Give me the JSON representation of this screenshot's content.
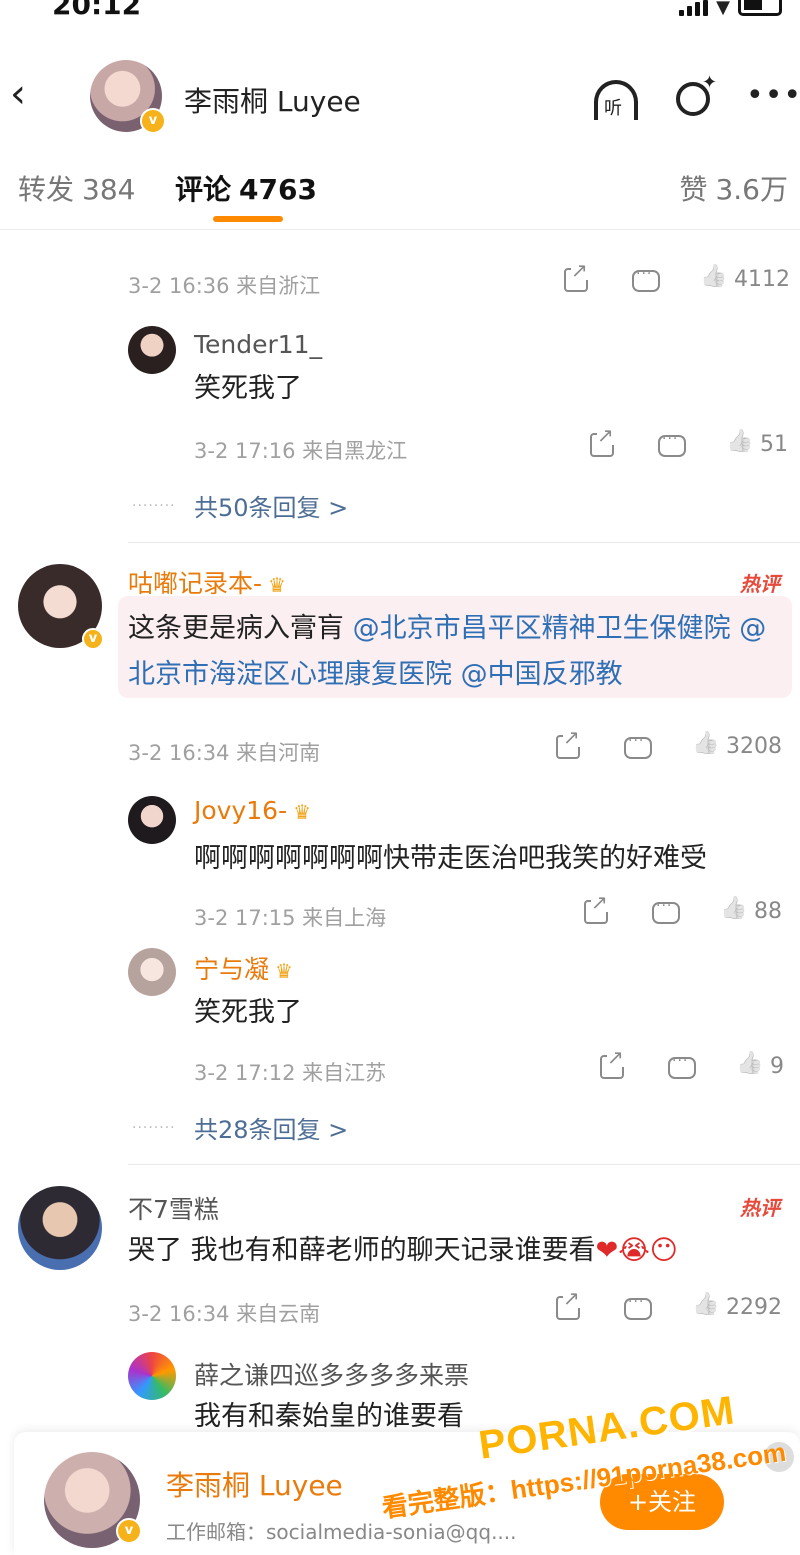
{
  "status_bar": {
    "time": "20:12"
  },
  "header": {
    "title": "李雨桐 Luyee",
    "listen_label": "听"
  },
  "tabs": {
    "forwards_label": "转发",
    "forwards_count": "384",
    "comments_label": "评论",
    "comments_count": "4763",
    "likes_label": "赞",
    "likes_count": "3.6万"
  },
  "comments": [
    {
      "meta": "3-2 16:36 来自浙江",
      "likes": "4112",
      "replies": [
        {
          "user": "Tender11_",
          "text": "笑死我了",
          "meta": "3-2 17:16 来自黑龙江",
          "likes": "51"
        }
      ],
      "more_replies": "共50条回复 >"
    },
    {
      "user": "咕嘟记录本-",
      "hot_badge": "热评",
      "text_parts": [
        "这条更是病入膏肓 ",
        "@北京市昌平区精神卫生保健院",
        " ",
        "@北京市海淀区心理康复医院",
        " ",
        "@中国反邪教"
      ],
      "meta": "3-2 16:34 来自河南",
      "likes": "3208",
      "replies": [
        {
          "user": "Jovy16-",
          "text": "啊啊啊啊啊啊啊快带走医治吧我笑的好难受",
          "meta": "3-2 17:15 来自上海",
          "likes": "88"
        },
        {
          "user": "宁与凝",
          "text": "笑死我了",
          "meta": "3-2 17:12 来自江苏",
          "likes": "9"
        }
      ],
      "more_replies": "共28条回复 >"
    },
    {
      "user": "不7雪糕",
      "hot_badge": "热评",
      "text": "哭了 我也有和薛老师的聊天记录谁要看",
      "emojis": "❤😭😶",
      "meta": "3-2 16:34 来自云南",
      "likes": "2292",
      "replies": [
        {
          "user": "薛之谦四巡多多多多来票",
          "text": "我有和秦始皇的谁要看"
        }
      ]
    }
  ],
  "footer": {
    "name": "李雨桐 Luyee",
    "email": "工作邮箱：socialmedia-sonia@qq....",
    "follow_label": "+关注"
  },
  "watermark": {
    "line1": "PORNA.COM",
    "line2": "看完整版：https://91porna38.com"
  },
  "colors": {
    "accent": "#ff8a00",
    "username": "#e97b0c",
    "link": "#2f6fb5",
    "hot": "#e74a3b"
  }
}
